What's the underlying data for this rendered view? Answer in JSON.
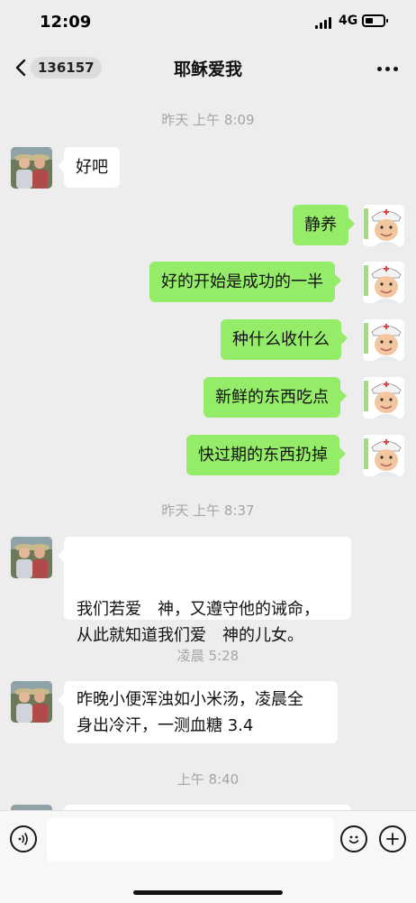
{
  "status_bar": {
    "time": "12:09",
    "network": "4G"
  },
  "header": {
    "unread_count": "136157",
    "title": "耶稣爱我"
  },
  "timestamps": [
    "昨天 上午 8:09",
    "昨天 上午 8:37",
    "凌晨 5:28",
    "上午 8:40"
  ],
  "messages": [
    {
      "side": "left",
      "text": "好吧"
    },
    {
      "side": "right",
      "text": "静养"
    },
    {
      "side": "right",
      "text": "好的开始是成功的一半"
    },
    {
      "side": "right",
      "text": "种什么收什么"
    },
    {
      "side": "right",
      "text": "新鲜的东西吃点"
    },
    {
      "side": "right",
      "text": "快过期的东西扔掉"
    },
    {
      "side": "left",
      "text": "我们若爱　神，又遵守他的诫命，\n从此就知道我们爱　神的儿女。"
    },
    {
      "side": "left",
      "text": "昨晚小便浑浊如小米汤，凌晨全\n身出冷汗，一测血糖 3.4"
    },
    {
      "side": "left",
      "text": ""
    }
  ],
  "colors": {
    "background": "#ededed",
    "bubble_sent": "#95ec69",
    "bubble_received": "#ffffff",
    "timestamp": "#a5a5a5"
  },
  "icons": [
    "back-icon",
    "more-icon",
    "voice-icon",
    "emoji-icon",
    "plus-icon",
    "rose-emoji"
  ]
}
